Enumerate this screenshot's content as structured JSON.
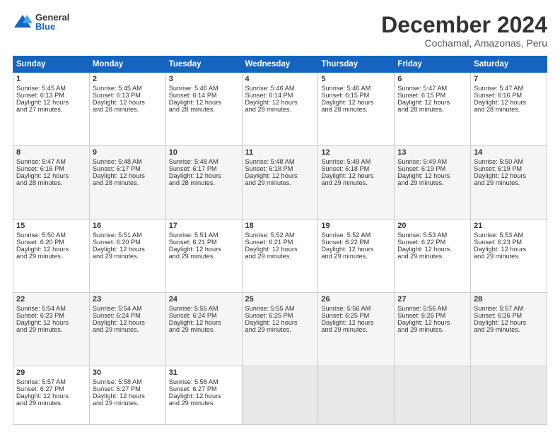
{
  "logo": {
    "general": "General",
    "blue": "Blue"
  },
  "title": "December 2024",
  "location": "Cochamal, Amazonas, Peru",
  "days_header": [
    "Sunday",
    "Monday",
    "Tuesday",
    "Wednesday",
    "Thursday",
    "Friday",
    "Saturday"
  ],
  "weeks": [
    [
      {
        "day": "1",
        "sunrise": "5:45 AM",
        "sunset": "6:13 PM",
        "daylight": "12 hours and 27 minutes."
      },
      {
        "day": "2",
        "sunrise": "5:45 AM",
        "sunset": "6:13 PM",
        "daylight": "12 hours and 28 minutes."
      },
      {
        "day": "3",
        "sunrise": "5:46 AM",
        "sunset": "6:14 PM",
        "daylight": "12 hours and 28 minutes."
      },
      {
        "day": "4",
        "sunrise": "5:46 AM",
        "sunset": "6:14 PM",
        "daylight": "12 hours and 28 minutes."
      },
      {
        "day": "5",
        "sunrise": "5:46 AM",
        "sunset": "6:15 PM",
        "daylight": "12 hours and 28 minutes."
      },
      {
        "day": "6",
        "sunrise": "5:47 AM",
        "sunset": "6:15 PM",
        "daylight": "12 hours and 28 minutes."
      },
      {
        "day": "7",
        "sunrise": "5:47 AM",
        "sunset": "6:16 PM",
        "daylight": "12 hours and 28 minutes."
      }
    ],
    [
      {
        "day": "8",
        "sunrise": "5:47 AM",
        "sunset": "6:16 PM",
        "daylight": "12 hours and 28 minutes."
      },
      {
        "day": "9",
        "sunrise": "5:48 AM",
        "sunset": "6:17 PM",
        "daylight": "12 hours and 28 minutes."
      },
      {
        "day": "10",
        "sunrise": "5:48 AM",
        "sunset": "6:17 PM",
        "daylight": "12 hours and 28 minutes."
      },
      {
        "day": "11",
        "sunrise": "5:48 AM",
        "sunset": "6:18 PM",
        "daylight": "12 hours and 29 minutes."
      },
      {
        "day": "12",
        "sunrise": "5:49 AM",
        "sunset": "6:18 PM",
        "daylight": "12 hours and 29 minutes."
      },
      {
        "day": "13",
        "sunrise": "5:49 AM",
        "sunset": "6:19 PM",
        "daylight": "12 hours and 29 minutes."
      },
      {
        "day": "14",
        "sunrise": "5:50 AM",
        "sunset": "6:19 PM",
        "daylight": "12 hours and 29 minutes."
      }
    ],
    [
      {
        "day": "15",
        "sunrise": "5:50 AM",
        "sunset": "6:20 PM",
        "daylight": "12 hours and 29 minutes."
      },
      {
        "day": "16",
        "sunrise": "5:51 AM",
        "sunset": "6:20 PM",
        "daylight": "12 hours and 29 minutes."
      },
      {
        "day": "17",
        "sunrise": "5:51 AM",
        "sunset": "6:21 PM",
        "daylight": "12 hours and 29 minutes."
      },
      {
        "day": "18",
        "sunrise": "5:52 AM",
        "sunset": "6:21 PM",
        "daylight": "12 hours and 29 minutes."
      },
      {
        "day": "19",
        "sunrise": "5:52 AM",
        "sunset": "6:22 PM",
        "daylight": "12 hours and 29 minutes."
      },
      {
        "day": "20",
        "sunrise": "5:53 AM",
        "sunset": "6:22 PM",
        "daylight": "12 hours and 29 minutes."
      },
      {
        "day": "21",
        "sunrise": "5:53 AM",
        "sunset": "6:23 PM",
        "daylight": "12 hours and 29 minutes."
      }
    ],
    [
      {
        "day": "22",
        "sunrise": "5:54 AM",
        "sunset": "6:23 PM",
        "daylight": "12 hours and 29 minutes."
      },
      {
        "day": "23",
        "sunrise": "5:54 AM",
        "sunset": "6:24 PM",
        "daylight": "12 hours and 29 minutes."
      },
      {
        "day": "24",
        "sunrise": "5:55 AM",
        "sunset": "6:24 PM",
        "daylight": "12 hours and 29 minutes."
      },
      {
        "day": "25",
        "sunrise": "5:55 AM",
        "sunset": "6:25 PM",
        "daylight": "12 hours and 29 minutes."
      },
      {
        "day": "26",
        "sunrise": "5:56 AM",
        "sunset": "6:25 PM",
        "daylight": "12 hours and 29 minutes."
      },
      {
        "day": "27",
        "sunrise": "5:56 AM",
        "sunset": "6:26 PM",
        "daylight": "12 hours and 29 minutes."
      },
      {
        "day": "28",
        "sunrise": "5:57 AM",
        "sunset": "6:26 PM",
        "daylight": "12 hours and 29 minutes."
      }
    ],
    [
      {
        "day": "29",
        "sunrise": "5:57 AM",
        "sunset": "6:27 PM",
        "daylight": "12 hours and 29 minutes."
      },
      {
        "day": "30",
        "sunrise": "5:58 AM",
        "sunset": "6:27 PM",
        "daylight": "12 hours and 29 minutes."
      },
      {
        "day": "31",
        "sunrise": "5:58 AM",
        "sunset": "6:27 PM",
        "daylight": "12 hours and 29 minutes."
      },
      null,
      null,
      null,
      null
    ]
  ],
  "labels": {
    "sunrise": "Sunrise:",
    "sunset": "Sunset:",
    "daylight": "Daylight:"
  }
}
